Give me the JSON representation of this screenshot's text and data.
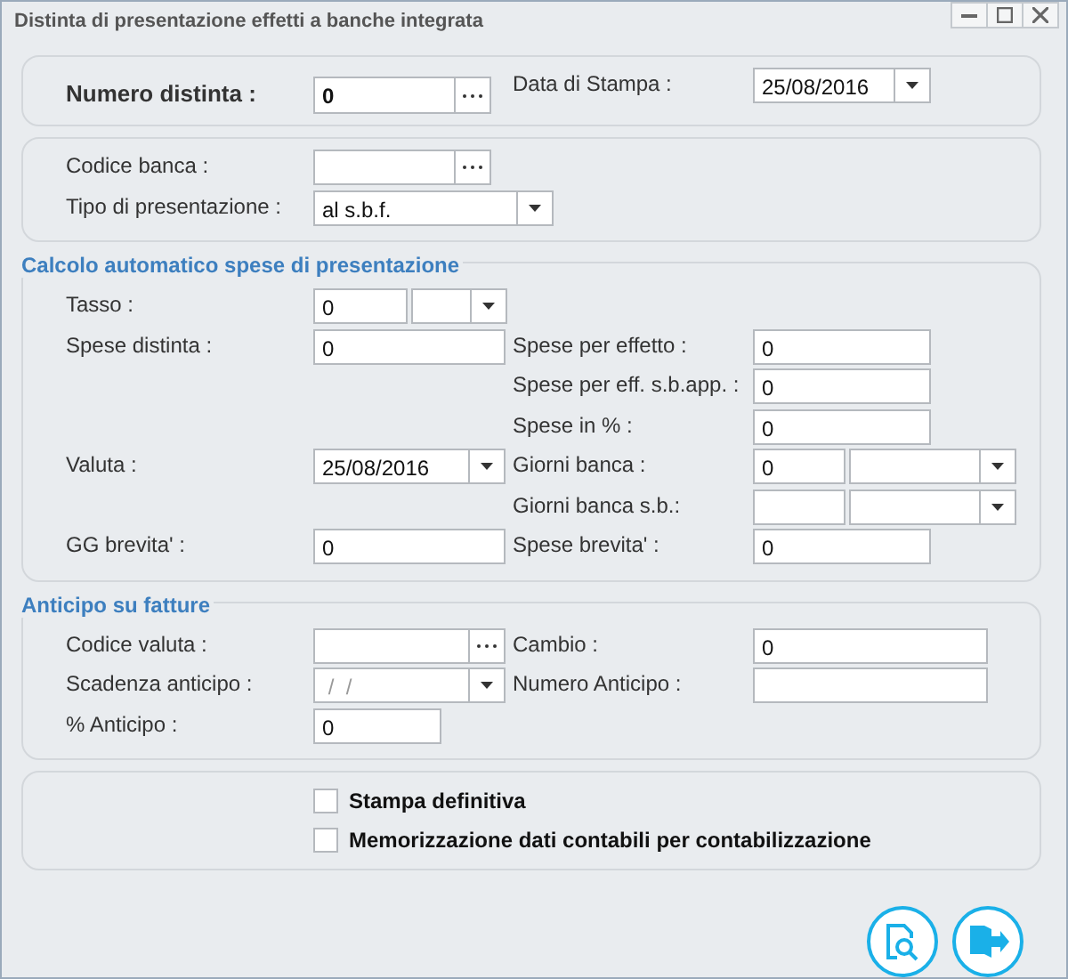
{
  "window": {
    "title": "Distinta di presentazione effetti a banche integrata"
  },
  "sections": [
    {
      "rows": [
        {
          "left": {
            "label": "Numero distinta :",
            "kind": "lookup",
            "value": "0",
            "emphasis": true
          },
          "right": {
            "label": "Data di Stampa :",
            "kind": "date",
            "value": "25/08/2016"
          }
        }
      ]
    },
    {
      "rows": [
        {
          "left": {
            "label": "Codice banca :",
            "kind": "lookup"
          }
        },
        {
          "left": {
            "label": "Tipo di presentazione :",
            "kind": "select",
            "value": "al s.b.f."
          }
        }
      ]
    },
    {
      "title": "Calcolo automatico spese di presentazione",
      "rows": [
        {
          "left": {
            "label": "Tasso :",
            "kind": "rate",
            "value": "0"
          }
        },
        {
          "left": {
            "label": "Spese distinta :",
            "kind": "text",
            "value": "0"
          },
          "right": {
            "label": "Spese per effetto :",
            "kind": "text",
            "value": "0"
          }
        },
        {
          "right": {
            "label": "Spese per eff. s.b.app. :",
            "kind": "text",
            "value": "0"
          }
        },
        {
          "right": {
            "label": "Spese in % :",
            "kind": "text",
            "value": "0"
          }
        },
        {
          "left": {
            "label": "Valuta :",
            "kind": "date",
            "value": "25/08/2016"
          },
          "right": {
            "label": "Giorni banca :",
            "kind": "days",
            "value": "0"
          }
        },
        {
          "right": {
            "label": "Giorni banca s.b.:",
            "kind": "days"
          }
        },
        {
          "left": {
            "label": "GG brevita' :",
            "kind": "text",
            "value": "0"
          },
          "right": {
            "label": "Spese brevita' :",
            "kind": "text",
            "value": "0"
          }
        }
      ]
    },
    {
      "title": "Anticipo su fatture",
      "rows": [
        {
          "left": {
            "label": "Codice valuta :",
            "kind": "lookup"
          },
          "right": {
            "label": "Cambio :",
            "kind": "text",
            "value": "0"
          }
        },
        {
          "left": {
            "label": "Scadenza anticipo :",
            "kind": "date",
            "placeholder": " /  /"
          },
          "right": {
            "label": "Numero Anticipo :",
            "kind": "text"
          }
        },
        {
          "left": {
            "label": "% Anticipo :",
            "kind": "percent",
            "value": "0"
          }
        }
      ]
    }
  ],
  "options": [
    {
      "label": "Stampa definitiva",
      "checked": false
    },
    {
      "label": "Memorizzazione dati contabili per contabilizzazione",
      "checked": false
    }
  ],
  "buttons": [
    {
      "kind": "preview"
    },
    {
      "kind": "exit"
    }
  ]
}
